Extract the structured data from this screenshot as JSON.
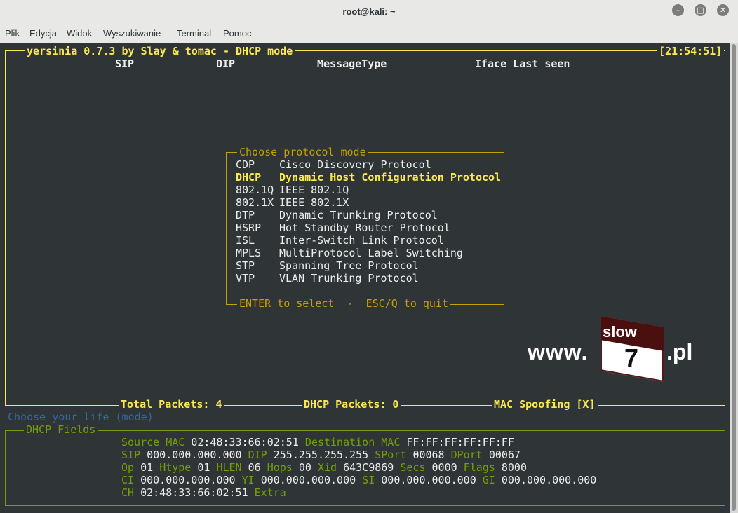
{
  "window": {
    "title": "root@kali: ~",
    "buttons": [
      "minimize",
      "maximize",
      "close"
    ]
  },
  "menu": [
    "Plik",
    "Edycja",
    "Widok",
    "Wyszukiwanie",
    "Terminal",
    "Pomoc"
  ],
  "header": {
    "title": "yersinia 0.7.3 by Slay & tomac - DHCP mode",
    "clock": "[21:54:51]"
  },
  "columns": {
    "sip": "SIP",
    "dip": "DIP",
    "type": "MessageType",
    "iface": "Iface Last seen"
  },
  "dialog": {
    "title": "Choose protocol mode",
    "items": [
      {
        "code": "CDP",
        "name": "Cisco Discovery Protocol"
      },
      {
        "code": "DHCP",
        "name": "Dynamic Host Configuration Protocol"
      },
      {
        "code": "802.1Q",
        "name": "IEEE 802.1Q"
      },
      {
        "code": "802.1X",
        "name": "IEEE 802.1X"
      },
      {
        "code": "DTP",
        "name": "Dynamic Trunking Protocol"
      },
      {
        "code": "HSRP",
        "name": "Hot Standby Router Protocol"
      },
      {
        "code": "ISL",
        "name": "Inter-Switch Link Protocol"
      },
      {
        "code": "MPLS",
        "name": "MultiProtocol Label Switching"
      },
      {
        "code": "STP",
        "name": "Spanning Tree Protocol"
      },
      {
        "code": "VTP",
        "name": "VLAN Trunking Protocol"
      }
    ],
    "selected_index": 1,
    "footer": "ENTER to select  -  ESC/Q to quit"
  },
  "watermark": {
    "prefix": "www.",
    "badge_top": "slow",
    "badge_num": "7",
    "suffix": ".pl"
  },
  "status": {
    "total": "Total Packets: 4",
    "dhcp": "DHCP Packets: 0",
    "mac": "MAC Spoofing [X]"
  },
  "prompt": "Choose your life (mode)",
  "fields": {
    "title": "DHCP Fields",
    "r1": {
      "l1": "Source MAC",
      "v1": "02:48:33:66:02:51",
      "l2": "Destination MAC",
      "v2": "FF:FF:FF:FF:FF:FF"
    },
    "r2": {
      "l1": "SIP",
      "v1": "000.000.000.000",
      "l2": "DIP",
      "v2": "255.255.255.255",
      "l3": "SPort",
      "v3": "00068",
      "l4": "DPort",
      "v4": "00067"
    },
    "r3": {
      "l1": "Op",
      "v1": "01",
      "l2": "Htype",
      "v2": "01",
      "l3": "HLEN",
      "v3": "06",
      "l4": "Hops",
      "v4": "00",
      "l5": "Xid",
      "v5": "643C9869",
      "l6": "Secs",
      "v6": "0000",
      "l7": "Flags",
      "v7": "8000"
    },
    "r4": {
      "l1": "CI",
      "v1": "000.000.000.000",
      "l2": "YI",
      "v2": "000.000.000.000",
      "l3": "SI",
      "v3": "000.000.000.000",
      "l4": "GI",
      "v4": "000.000.000.000"
    },
    "r5": {
      "l1": "CH",
      "v1": "02:48:33:66:02:51",
      "l2": "Extra"
    }
  },
  "colors": {
    "terminal_bg": "#2f3436",
    "accent_yellow": "#fce94f",
    "border_gold": "#c4a000",
    "field_green": "#73a000",
    "prompt_blue": "#3465a4"
  }
}
